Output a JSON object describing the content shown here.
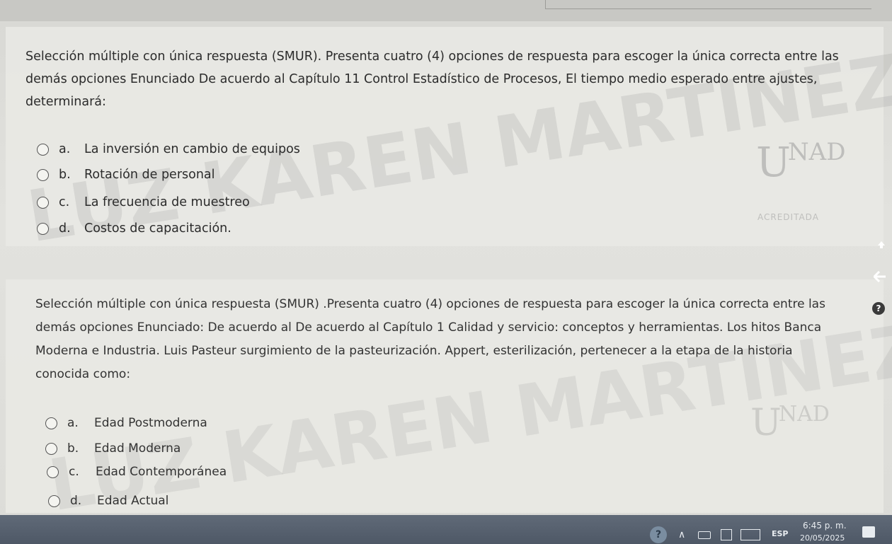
{
  "question1": {
    "text": "Selección múltiple con única respuesta (SMUR). Presenta cuatro (4) opciones de respuesta para escoger la única correcta entre las demás opciones Enunciado De acuerdo al Capítulo 11 Control Estadístico de Procesos, El tiempo medio esperado entre ajustes, determinará:",
    "options": [
      {
        "letter": "a.",
        "label": "La inversión en cambio de equipos"
      },
      {
        "letter": "b.",
        "label": "Rotación de personal"
      },
      {
        "letter": "c.",
        "label": "La frecuencia de muestreo"
      },
      {
        "letter": "d.",
        "label": "Costos de capacitación."
      }
    ]
  },
  "question2": {
    "text": "Selección múltiple con única respuesta (SMUR) .Presenta cuatro (4) opciones de respuesta para escoger la única correcta entre las demás opciones Enunciado: De acuerdo al De acuerdo al Capítulo 1 Calidad y servicio: conceptos y herramientas. Los hitos Banca Moderna e Industria. Luis Pasteur surgimiento de la pasteurización. Appert, esterilización, pertenecer a la etapa de la historia conocida como:",
    "options": [
      {
        "letter": "a.",
        "label": "Edad Postmoderna"
      },
      {
        "letter": "b.",
        "label": "Edad Moderna"
      },
      {
        "letter": "c.",
        "label": "Edad Contemporánea"
      },
      {
        "letter": "d.",
        "label": "Edad Actual"
      }
    ]
  },
  "watermark": {
    "name1": "LUZ KAREN MARTINEZ ANAYA",
    "name2": "LUZ KAREN MARTINEZ ANAYA",
    "logo_u": "U",
    "logo_nad": "NAD",
    "accredited": "ACREDITADA"
  },
  "taskbar": {
    "help_icon": "question-circle-icon",
    "language": "ESP",
    "time": "6:45 p. m.",
    "date": "20/05/2025"
  },
  "colors": {
    "page_bg": "#dcdcd8",
    "text": "#2b2b2b",
    "taskbar": "#55606e"
  }
}
